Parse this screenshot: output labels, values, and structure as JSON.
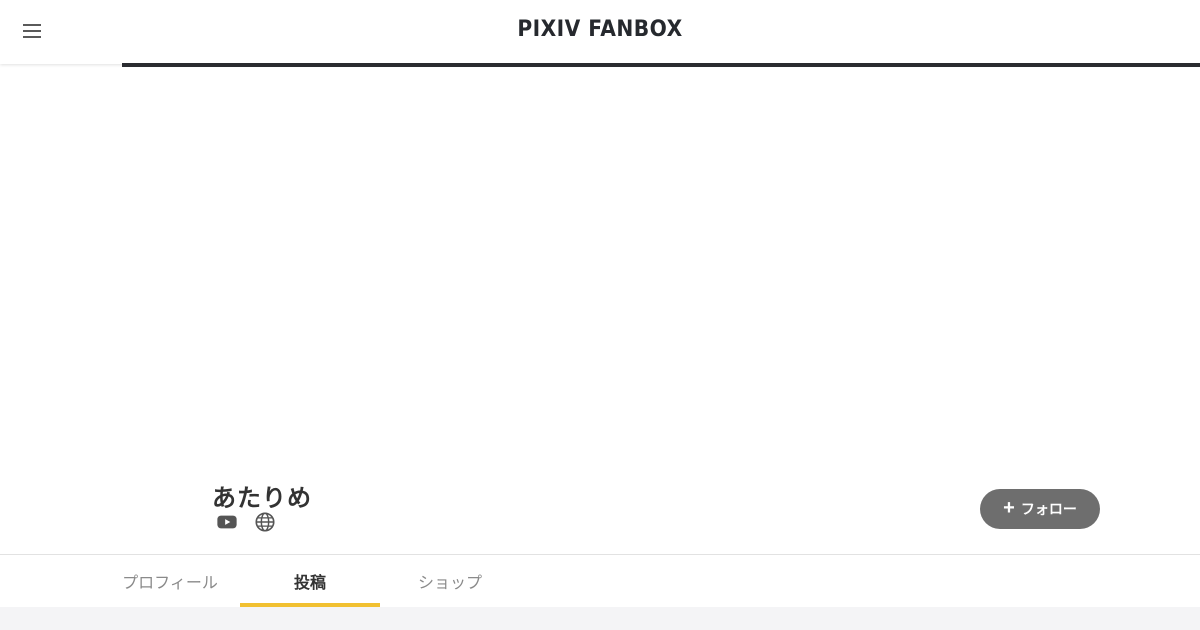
{
  "header": {
    "logo_text": "PIXIV FANBOX",
    "menu_icon": "hamburger-menu-icon"
  },
  "creator": {
    "name": "あたりめ",
    "links": [
      {
        "icon": "youtube-icon"
      },
      {
        "icon": "globe-icon"
      }
    ],
    "follow_label": "フォロー"
  },
  "tabs": [
    {
      "label": "プロフィール",
      "active": false
    },
    {
      "label": "投稿",
      "active": true
    },
    {
      "label": "ショップ",
      "active": false
    }
  ],
  "colors": {
    "accent": "#f1c031",
    "follow_button": "#6e6e6e",
    "progress_bar": "#2a2c30",
    "content_background": "#f4f4f6"
  }
}
